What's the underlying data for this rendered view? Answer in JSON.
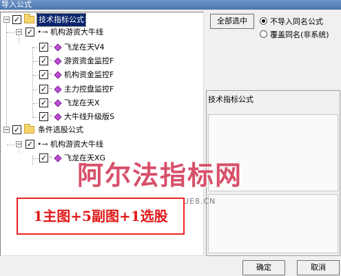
{
  "window": {
    "title": "导入公式"
  },
  "tree": {
    "group1": {
      "label": "技术指标公式",
      "sub": {
        "label": "机构游资大牛线",
        "items": [
          "飞龙在天V4",
          "游资资金监控F",
          "机构资金监控F",
          "主力控盘监控F",
          "飞龙在天X",
          "大牛线升级版S"
        ]
      }
    },
    "group2": {
      "label": "条件选股公式",
      "sub": {
        "label": "机构游资大牛线",
        "items": [
          "飞龙在天XG"
        ]
      }
    }
  },
  "options": {
    "select_all_label": "全部选中",
    "radio_skip_label": "不导入同名公式",
    "radio_overwrite_label": "覆盖同名(非系统)",
    "selected_option": "不导入同名公式"
  },
  "info": {
    "category_label": "技术指标公式"
  },
  "buttons": {
    "ok": "确定",
    "cancel": "取消"
  },
  "overlay": {
    "watermark": "阿尔法指标网",
    "watermark_url": "WWW.GUXUE8.CN",
    "promo": "1主图+5副图+1选股"
  },
  "colors": {
    "selection": "#0a246a",
    "promo_red": "#e01818",
    "watermark": "#d8506a"
  }
}
